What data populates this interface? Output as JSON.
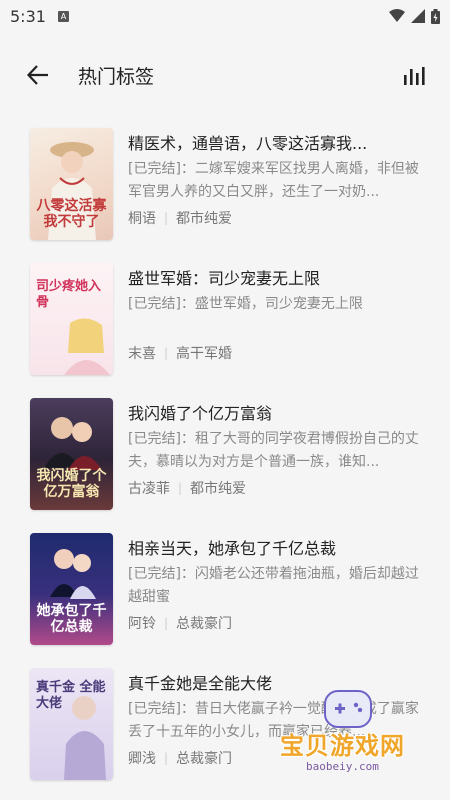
{
  "status": {
    "time": "5:31",
    "notification_badge": "A"
  },
  "header": {
    "title": "热门标签"
  },
  "books": [
    {
      "title": "精医术，通兽语，八零这活寡我...",
      "summary": "[已完结]：二嫁军嫂来军区找男人离婚，非但被军官男人养的又白又胖，还生了一对奶...",
      "author": "桐语",
      "category": "都市纯爱",
      "cover_text": "八零这活寡 我不守了",
      "cover_bg": "#f4e8dc",
      "cover_color": "#c23b3b"
    },
    {
      "title": "盛世军婚：司少宠妻无上限",
      "summary": "[已完结]：盛世军婚，司少宠妻无上限",
      "author": "末喜",
      "category": "高干军婚",
      "cover_text": "司少疼她入骨",
      "cover_bg": "#fbeef2",
      "cover_color": "#d0325a"
    },
    {
      "title": "我闪婚了个亿万富翁",
      "summary": "[已完结]：租了大哥的同学夜君博假扮自己的丈夫，慕晴以为对方是个普通一族，谁知...",
      "author": "古凌菲",
      "category": "都市纯爱",
      "cover_text": "我闪婚了个亿万富翁",
      "cover_bg": "#3b3048",
      "cover_color": "#f6e6b0"
    },
    {
      "title": "相亲当天，她承包了千亿总裁",
      "summary": "[已完结]：闪婚老公还带着拖油瓶，婚后却越过越甜蜜",
      "author": "阿铃",
      "category": "总裁豪门",
      "cover_text": "她承包了千亿总裁",
      "cover_bg": "#2a2f6a",
      "cover_color": "#ffffff"
    },
    {
      "title": "真千金她是全能大佬",
      "summary": "[已完结]：昔日大佬赢子衿一觉醒来，成了赢家丢了十五年的小女儿，而赢家已经养...",
      "author": "卿浅",
      "category": "总裁豪门",
      "cover_text": "真千金 全能大佬",
      "cover_bg": "#e7e2f2",
      "cover_color": "#4a3a7a"
    }
  ],
  "watermark": {
    "text": "宝贝游戏网",
    "url": "baobeiy.com"
  }
}
